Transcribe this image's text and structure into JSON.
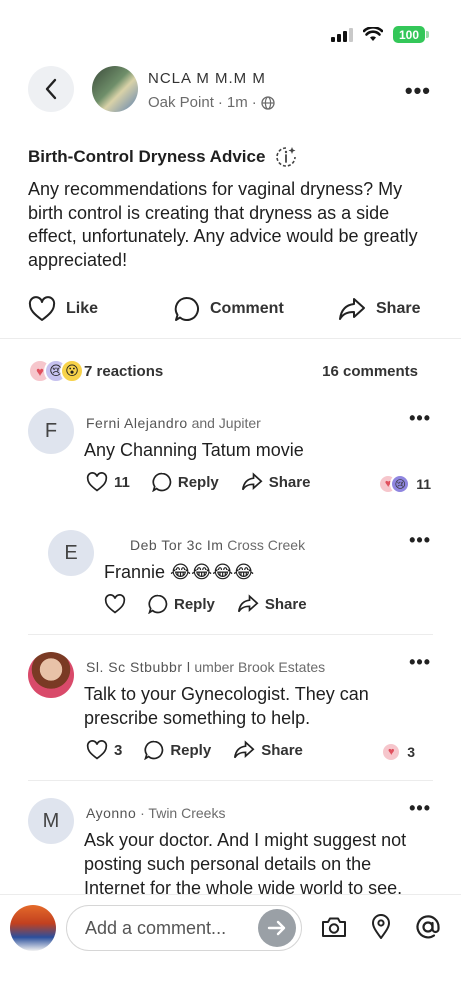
{
  "status_bar": {
    "battery": "100"
  },
  "post": {
    "author_name": "NCLA  M  M.M  M",
    "neighborhood": "Oak Point",
    "time": "1m",
    "title": "Birth-Control Dryness Advice",
    "body": "Any recommendations for vaginal dryness? My birth control is creating that dryness as a side effect, unfortunately. Any advice would be greatly  appreciated!"
  },
  "actions": {
    "like": "Like",
    "comment": "Comment",
    "share": "Share"
  },
  "summary": {
    "reactions": "7 reactions",
    "comments": "16 comments"
  },
  "comments": [
    {
      "initial": "F",
      "author": "Ferni Alejandro",
      "neighborhood": "and Jupiter",
      "text": "Any Channing Tatum movie",
      "likes": "11",
      "reply": "Reply",
      "share": "Share",
      "reaction_count": "11"
    },
    {
      "initial": "E",
      "author": "Deb  Tor 3c  Im",
      "neighborhood": "Cross Creek",
      "text": "Frannie 😂😂😂😂",
      "reply": "Reply",
      "share": "Share"
    },
    {
      "author": "Sl. Sc Stbubbr l",
      "neighborhood": "umber Brook Estates",
      "text": "Talk to your Gynecologist. They can prescribe something to help.",
      "likes": "3",
      "reply": "Reply",
      "share": "Share",
      "reaction_count": "3"
    },
    {
      "initial": "M",
      "author": "Ayonno",
      "neighborhood": "· Twin Creeks",
      "text": "Ask your doctor. And I might suggest not posting such personal details on the Internet for the whole wide world to see."
    }
  ],
  "composer": {
    "placeholder": "Add a comment..."
  },
  "colors": {
    "accent_gray": "#9aa0a6",
    "battery_green": "#34c759",
    "avatar_bg": "#dfe4ee"
  }
}
